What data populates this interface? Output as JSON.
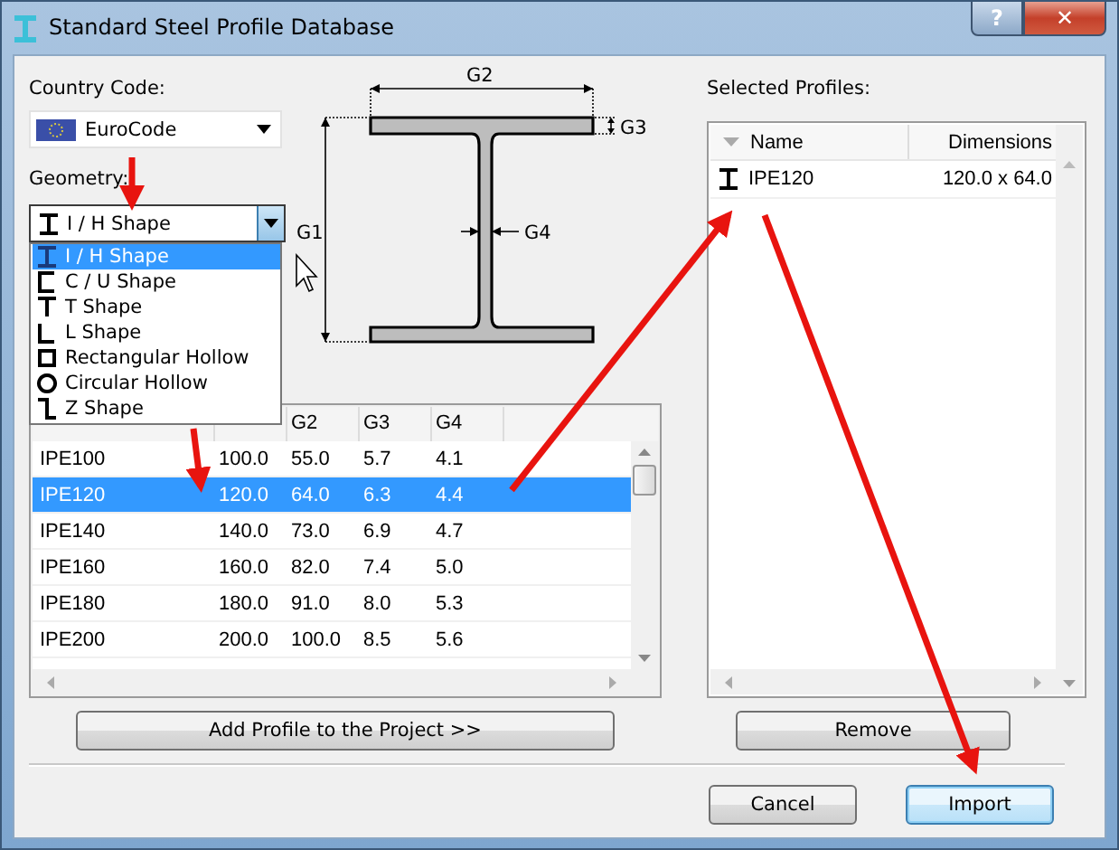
{
  "window": {
    "title": "Standard Steel Profile Database",
    "help_button": "?",
    "close_button": "✕"
  },
  "country_code": {
    "label": "Country Code:",
    "value": "EuroCode"
  },
  "geometry": {
    "label": "Geometry:",
    "value": "I / H Shape",
    "kind": "ibeam",
    "expanded": true,
    "options": [
      {
        "label": "I / H Shape",
        "kind": "ibeam",
        "selected": true
      },
      {
        "label": "C / U Shape",
        "kind": "channel",
        "selected": false
      },
      {
        "label": "T Shape",
        "kind": "tee",
        "selected": false
      },
      {
        "label": "L Shape",
        "kind": "angle",
        "selected": false
      },
      {
        "label": "Rectangular Hollow",
        "kind": "box",
        "selected": false
      },
      {
        "label": "Circular Hollow",
        "kind": "pipe",
        "selected": false
      },
      {
        "label": "Z Shape",
        "kind": "zee",
        "selected": false
      }
    ]
  },
  "diagram": {
    "labels": [
      "G2",
      "G3",
      "G1",
      "G4"
    ]
  },
  "profiles_table": {
    "visible_headers": [
      "G2",
      "G3",
      "G4"
    ],
    "rows": [
      {
        "cells": [
          "IPE100",
          "100.0",
          "55.0",
          "5.7",
          "4.1"
        ],
        "selected": false
      },
      {
        "cells": [
          "IPE120",
          "120.0",
          "64.0",
          "6.3",
          "4.4"
        ],
        "selected": true
      },
      {
        "cells": [
          "IPE140",
          "140.0",
          "73.0",
          "6.9",
          "4.7"
        ],
        "selected": false
      },
      {
        "cells": [
          "IPE160",
          "160.0",
          "82.0",
          "7.4",
          "5.0"
        ],
        "selected": false
      },
      {
        "cells": [
          "IPE180",
          "180.0",
          "91.0",
          "8.0",
          "5.3"
        ],
        "selected": false
      },
      {
        "cells": [
          "IPE200",
          "200.0",
          "100.0",
          "8.5",
          "5.6"
        ],
        "selected": false
      }
    ]
  },
  "add_button": "Add Profile to the Project >>",
  "selected_profiles": {
    "label": "Selected Profiles:",
    "columns": [
      "Name",
      "Dimensions"
    ],
    "rows": [
      {
        "kind": "ibeam",
        "name": "IPE120",
        "dimensions": "120.0 x 64.0"
      }
    ]
  },
  "remove_button": "Remove",
  "cancel_button": "Cancel",
  "import_button": {
    "label": "Import",
    "focused": true
  }
}
